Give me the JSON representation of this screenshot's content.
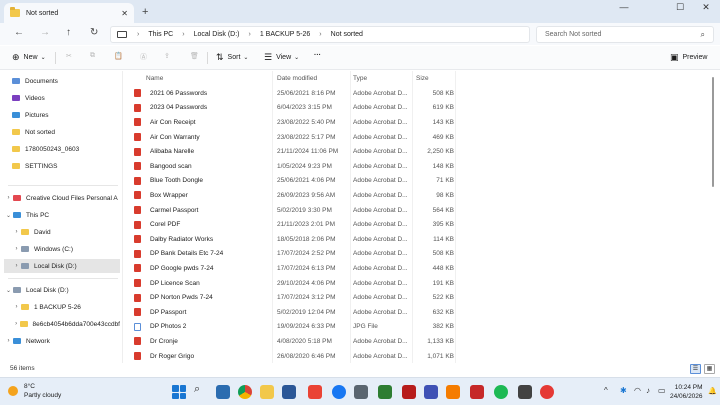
{
  "window": {
    "tab_title": "Not sorted",
    "tab_close": "✕",
    "new_tab": "+",
    "minimize": "—",
    "maximize": "☐",
    "close": "✕"
  },
  "address": {
    "back": "←",
    "forward": "→",
    "up": "↑",
    "refresh": "↻",
    "crumbs": [
      "This PC",
      "Local Disk (D:)",
      "1 BACKUP 5-26",
      "Not sorted"
    ],
    "separator": "›",
    "search_placeholder": "Search Not sorted"
  },
  "toolbar": {
    "new_label": "New",
    "sort_label": "Sort",
    "view_label": "View",
    "more_label": "···",
    "preview_label": "Preview"
  },
  "sidebar": {
    "quick": [
      {
        "label": "Documents",
        "pinned": true
      },
      {
        "label": "Videos",
        "pinned": true
      },
      {
        "label": "Pictures",
        "pinned": true
      },
      {
        "label": "Not sorted",
        "pinned": false
      },
      {
        "label": "1780050243_0603",
        "pinned": false
      },
      {
        "label": "SETTINGS",
        "pinned": false
      }
    ],
    "tree": [
      {
        "label": "Creative Cloud Files Personal A",
        "chevron": "›"
      },
      {
        "label": "This PC",
        "chevron": "⌄"
      },
      {
        "label": "David",
        "chevron": "›"
      },
      {
        "label": "Windows (C:)",
        "chevron": "›"
      },
      {
        "label": "Local Disk (D:)",
        "chevron": "›"
      },
      {
        "label": "Local Disk (D:)",
        "chevron": "⌄"
      },
      {
        "label": "1 BACKUP 5-26",
        "chevron": "›"
      },
      {
        "label": "8e6cb4054b6dda700e43ccdbf",
        "chevron": "›"
      },
      {
        "label": "Network",
        "chevron": "›"
      }
    ]
  },
  "columns": {
    "name": "Name",
    "date": "Date modified",
    "type": "Type",
    "size": "Size",
    "sort_indicator": "^"
  },
  "files": [
    {
      "name": "2021 06 Passwords",
      "date": "25/06/2021 8:16 PM",
      "type": "Adobe Acrobat D...",
      "size": "508 KB",
      "kind": "pdf"
    },
    {
      "name": "2023 04 Passwords",
      "date": "6/04/2023 3:15 PM",
      "type": "Adobe Acrobat D...",
      "size": "619 KB",
      "kind": "pdf"
    },
    {
      "name": "Air Con Receipt",
      "date": "23/08/2022 5:40 PM",
      "type": "Adobe Acrobat D...",
      "size": "143 KB",
      "kind": "pdf"
    },
    {
      "name": "Air Con Warranty",
      "date": "23/08/2022 5:17 PM",
      "type": "Adobe Acrobat D...",
      "size": "469 KB",
      "kind": "pdf"
    },
    {
      "name": "Alibaba Narelle",
      "date": "21/11/2024 11:06 PM",
      "type": "Adobe Acrobat D...",
      "size": "2,250 KB",
      "kind": "pdf"
    },
    {
      "name": "Bangood scan",
      "date": "1/05/2024 9:23 PM",
      "type": "Adobe Acrobat D...",
      "size": "148 KB",
      "kind": "pdf"
    },
    {
      "name": "Blue Tooth Dongle",
      "date": "25/06/2021 4:06 PM",
      "type": "Adobe Acrobat D...",
      "size": "71 KB",
      "kind": "pdf"
    },
    {
      "name": "Box Wrapper",
      "date": "26/09/2023 9:56 AM",
      "type": "Adobe Acrobat D...",
      "size": "98 KB",
      "kind": "pdf"
    },
    {
      "name": "Carmel Passport",
      "date": "5/02/2019 3:30 PM",
      "type": "Adobe Acrobat D...",
      "size": "564 KB",
      "kind": "pdf"
    },
    {
      "name": "Corel PDF",
      "date": "21/11/2023 2:01 PM",
      "type": "Adobe Acrobat D...",
      "size": "395 KB",
      "kind": "pdf"
    },
    {
      "name": "Dalby Radiator Works",
      "date": "18/05/2018 2:06 PM",
      "type": "Adobe Acrobat D...",
      "size": "114 KB",
      "kind": "pdf"
    },
    {
      "name": "DP Bank Details Etc 7-24",
      "date": "17/07/2024 2:52 PM",
      "type": "Adobe Acrobat D...",
      "size": "508 KB",
      "kind": "pdf"
    },
    {
      "name": "DP Google pwds 7-24",
      "date": "17/07/2024 6:13 PM",
      "type": "Adobe Acrobat D...",
      "size": "448 KB",
      "kind": "pdf"
    },
    {
      "name": "DP Licence Scan",
      "date": "29/10/2024 4:06 PM",
      "type": "Adobe Acrobat D...",
      "size": "191 KB",
      "kind": "pdf"
    },
    {
      "name": "DP Norton Pwds 7-24",
      "date": "17/07/2024 3:12 PM",
      "type": "Adobe Acrobat D...",
      "size": "522 KB",
      "kind": "pdf"
    },
    {
      "name": "DP Passport",
      "date": "5/02/2019 12:04 PM",
      "type": "Adobe Acrobat D...",
      "size": "632 KB",
      "kind": "pdf"
    },
    {
      "name": "DP Photos 2",
      "date": "19/09/2024 6:33 PM",
      "type": "JPG File",
      "size": "382 KB",
      "kind": "jpg"
    },
    {
      "name": "Dr Cronje",
      "date": "4/08/2020 5:18 PM",
      "type": "Adobe Acrobat D...",
      "size": "1,133 KB",
      "kind": "pdf"
    },
    {
      "name": "Dr Roger Grigo",
      "date": "26/08/2020 6:46 PM",
      "type": "Adobe Acrobat D...",
      "size": "1,071 KB",
      "kind": "pdf"
    }
  ],
  "status": {
    "item_count": "56 items"
  },
  "taskbar": {
    "temperature": "8°C",
    "condition": "Partly cloudy",
    "time": "10:24 PM",
    "date": "24/06/2026",
    "tray_chevron": "^"
  },
  "colors": {
    "accent": "#1976d2",
    "folder": "#f2c84b",
    "pdf": "#d83b2d",
    "selection": "#e5e5e5",
    "titlebar": "#dfe8f3",
    "taskbar": "#e6eef8"
  }
}
